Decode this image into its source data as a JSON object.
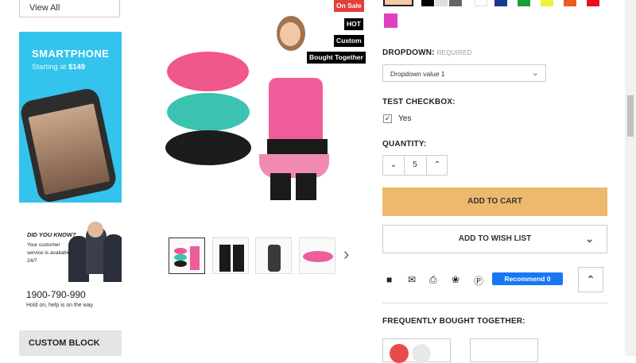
{
  "sidebar": {
    "view_all": "View All",
    "banner": {
      "title": "SMARTPHONE",
      "subtitle_prefix": "Starting at",
      "price": "$149"
    },
    "support": {
      "heading": "DID YOU KNOW?",
      "text": "Your customer service is available 24/7"
    },
    "phone": "1900-790-990",
    "hold_text": "Hold on, help is on the way",
    "custom_block": "CUSTOM BLOCK"
  },
  "product": {
    "badges": [
      "On Sale",
      "HOT",
      "Custom",
      "Bought Together"
    ]
  },
  "options": {
    "swatch_colors": [
      "#f5c8a8",
      "#000000",
      "#dddddd",
      "#666666",
      "#ffffff",
      "#1a3a8f",
      "#1a9e3a",
      "#eef03a",
      "#ef5a22",
      "#e8111b",
      "#e040c0"
    ],
    "dropdown_label": "DROPDOWN:",
    "dropdown_required": "REQUIRED",
    "dropdown_value": "Dropdown value 1",
    "checkbox_label": "TEST CHECKBOX:",
    "checkbox_option": "Yes",
    "quantity_label": "QUANTITY:",
    "quantity": "5"
  },
  "actions": {
    "add_to_cart": "ADD TO CART",
    "add_to_wishlist": "ADD TO WISH LIST",
    "recommend": "Recommend 0"
  },
  "bought_together": {
    "heading": "FREQUENTLY BOUGHT TOGETHER:"
  },
  "colors": {
    "accent": "#edb96d",
    "facebook": "#1877f2",
    "badge_sale": "#e2413a"
  }
}
